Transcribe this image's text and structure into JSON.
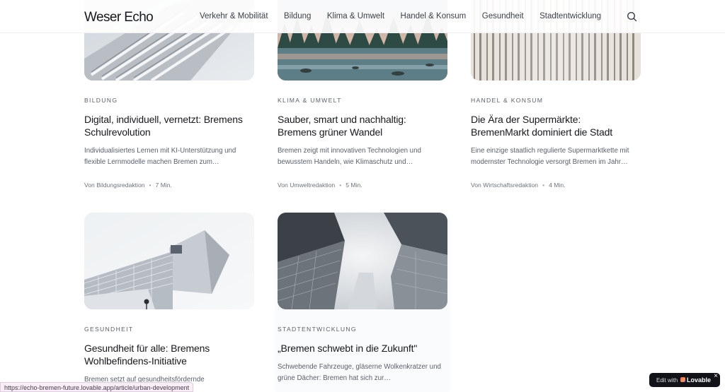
{
  "header": {
    "logo": "Weser Echo",
    "nav": [
      "Verkehr & Mobilität",
      "Bildung",
      "Klima & Umwelt",
      "Handel & Konsum",
      "Gesundheit",
      "Stadtentwicklung"
    ],
    "search_icon": "search-icon"
  },
  "articles": [
    {
      "category": "Bildung",
      "title": "Digital, individuell, vernetzt: Bremens Schulrevolution",
      "excerpt": "Individualisiertes Lernen mit KI-Unterstützung und flexible Lernmodelle machen Bremen zum…",
      "author": "Von Bildungsredaktion",
      "read_time": "7 Min.",
      "image": "modern-building-balconies"
    },
    {
      "category": "Klima & Umwelt",
      "title": "Sauber, smart und nachhaltig: Bremens grüner Wandel",
      "excerpt": "Bremen zeigt mit innovativen Technologien und bewusstem Handeln, wie Klimaschutz und…",
      "author": "Von Umweltredaktion",
      "read_time": "5 Min.",
      "image": "forest-river-landscape"
    },
    {
      "category": "Handel & Konsum",
      "title": "Die Ära der Supermärkte: BremenMarkt dominiert die Stadt",
      "excerpt": "Eine einzige staatlich regulierte Supermarktkette mit modernster Technologie versorgt Bremen im Jahr…",
      "author": "Von Wirtschaftsredaktion",
      "read_time": "4 Min.",
      "image": "vertical-slat-facade"
    },
    {
      "category": "Gesundheit",
      "title": "Gesundheit für alle: Bremens Wohlbefindens-Initiative",
      "excerpt": "Bremen setzt auf gesundheitsfördernde",
      "author": "",
      "read_time": "",
      "image": "glass-geometric-building"
    },
    {
      "category": "Stadtentwicklung",
      "title": "„Bremen schwebt in die Zukunft\"",
      "excerpt": "Schwebende Fahrzeuge, gläserne Wolkenkratzer und grüne Dächer: Bremen hat sich zur…",
      "author": "",
      "read_time": "",
      "image": "skyscrapers-looking-up"
    }
  ],
  "status_bar": {
    "url": "https://echo-bremen-future.lovable.app/article/urban-development"
  },
  "badge": {
    "edit_label": "Edit with",
    "brand": "Lovable",
    "close": "×"
  },
  "colors": {
    "background": "#ffffff",
    "text": "#16191d",
    "muted": "#5a616b",
    "badge_bg": "#111318"
  }
}
